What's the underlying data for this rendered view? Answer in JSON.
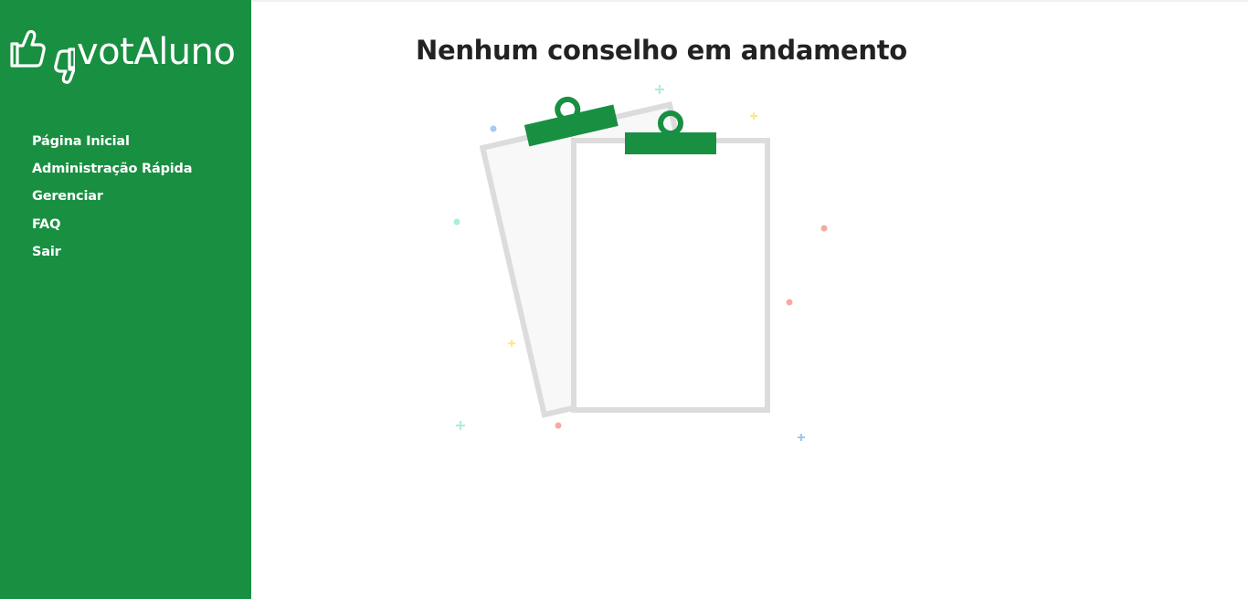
{
  "app": {
    "logo_text": "votAluno",
    "brand_color": "#198f42",
    "logo_icon": "thumbs-up-down-icon"
  },
  "sidebar": {
    "items": [
      {
        "label": "Página Inicial"
      },
      {
        "label": "Administração Rápida"
      },
      {
        "label": "Gerenciar"
      },
      {
        "label": "FAQ"
      },
      {
        "label": "Sair"
      }
    ]
  },
  "main": {
    "title": "Nenhum conselho em andamento",
    "illustration": "empty-clipboards-illustration"
  }
}
